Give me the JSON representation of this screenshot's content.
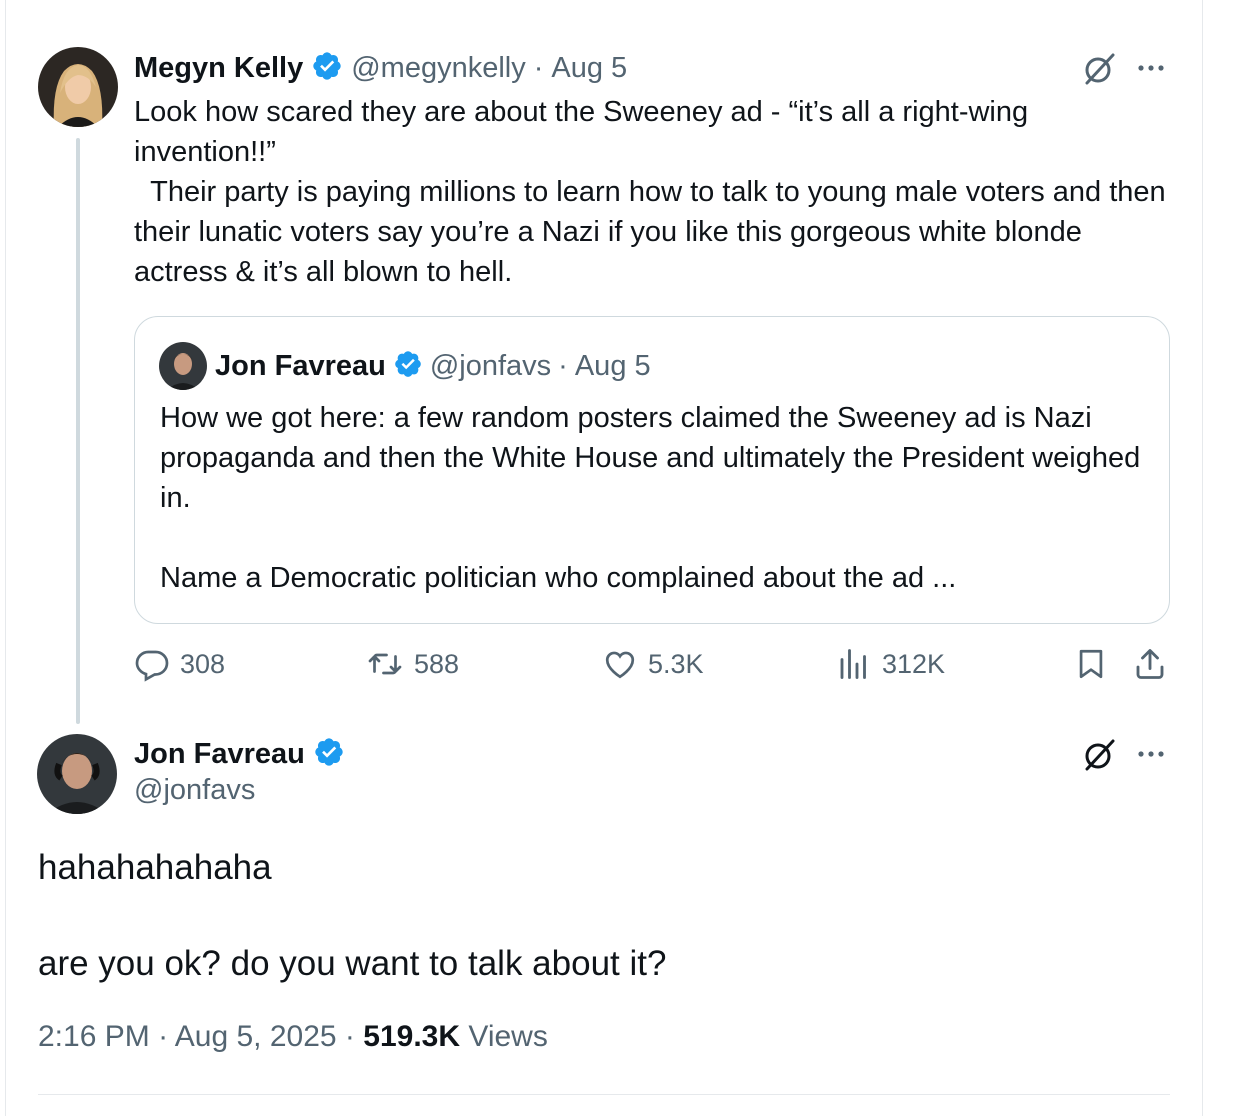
{
  "parent_tweet": {
    "name": "Megyn Kelly",
    "handle": "@megynkelly",
    "sep": "·",
    "date": "Aug 5",
    "text": "Look how scared they are about the Sweeney ad - “it’s all a right-wing invention!!”\n  Their party is paying millions to learn how to talk to young male voters and then their lunatic voters say you’re a Nazi if you like this gorgeous white blonde actress & it’s all blown to hell.",
    "quoted": {
      "name": "Jon Favreau",
      "handle": "@jonfavs",
      "sep": "·",
      "date": "Aug 5",
      "text": "How we got here: a few random posters claimed the Sweeney ad is Nazi propaganda and then the White House and ultimately the President weighed in.\n\nName a Democratic politician who complained about the ad ..."
    },
    "actions": {
      "replies": "308",
      "reposts": "588",
      "likes": "5.3K",
      "views": "312K"
    }
  },
  "main_tweet": {
    "name": "Jon Favreau",
    "handle": "@jonfavs",
    "text": "hahahahahaha\n\nare you ok? do you want to talk about it?",
    "time": "2:16 PM",
    "sep": "·",
    "date": "Aug 5, 2025",
    "views_count": "519.3K",
    "views_label": "Views"
  },
  "colors": {
    "verified": "#1d9bf0",
    "secondary_text": "#536471",
    "primary_text": "#0f1419",
    "border": "#cfd9de"
  },
  "icons": [
    "grok-icon",
    "more-icon",
    "verified-badge-icon",
    "reply-icon",
    "repost-icon",
    "like-icon",
    "views-icon",
    "bookmark-icon",
    "share-icon"
  ]
}
